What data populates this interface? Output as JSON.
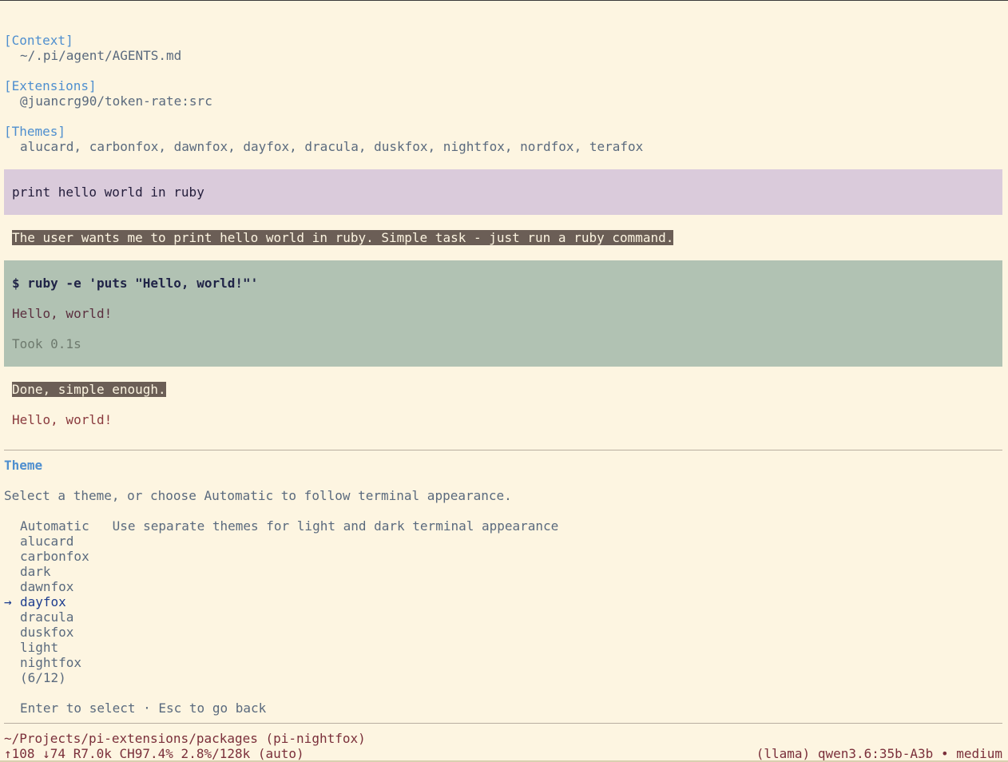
{
  "context": {
    "label": "[Context]",
    "value": "~/.pi/agent/AGENTS.md"
  },
  "extensions": {
    "label": "[Extensions]",
    "value": "@juancrg90/token-rate:src"
  },
  "themes": {
    "label": "[Themes]",
    "value": "alucard, carbonfox, dawnfox, dayfox, dracula, duskfox, nightfox, nordfox, terafox"
  },
  "conversation": {
    "user_prompt": "print hello world in ruby",
    "thinking": "The user wants me to print hello world in ruby. Simple task - just run a ruby command.",
    "tool_command": "$ ruby -e 'puts \"Hello, world!\"'",
    "tool_output": "Hello, world!",
    "tool_time": "Took 0.1s",
    "thinking2": "Done, simple enough.",
    "response": "Hello, world!"
  },
  "theme_picker": {
    "title": "Theme",
    "description": "Select a theme, or choose Automatic to follow terminal appearance.",
    "options": [
      {
        "name": "Automatic",
        "description": "Use separate themes for light and dark terminal appearance"
      },
      {
        "name": "alucard"
      },
      {
        "name": "carbonfox"
      },
      {
        "name": "dark"
      },
      {
        "name": "dawnfox"
      },
      {
        "name": "dayfox",
        "selected": true
      },
      {
        "name": "dracula"
      },
      {
        "name": "duskfox"
      },
      {
        "name": "light"
      },
      {
        "name": "nightfox"
      }
    ],
    "selection_arrow": "→",
    "counter": "(6/12)",
    "hint": "Enter to select · Esc to go back"
  },
  "footer": {
    "cwd": "~/Projects/pi-extensions/packages (pi-nightfox)",
    "stats": "↑108 ↓74 R7.0k CH97.4% 2.8%/128k (auto)",
    "model": "(llama) qwen3.6:35b-A3b • medium"
  },
  "colors": {
    "background": "#fdf5e1",
    "accent": "#4f8fcf",
    "user_block": "#dacbdb",
    "tool_block": "#b1c2b3",
    "thinking_bg": "#6b5e56",
    "selected": "#1d3d8f",
    "footer_text": "#7a2f3a"
  }
}
